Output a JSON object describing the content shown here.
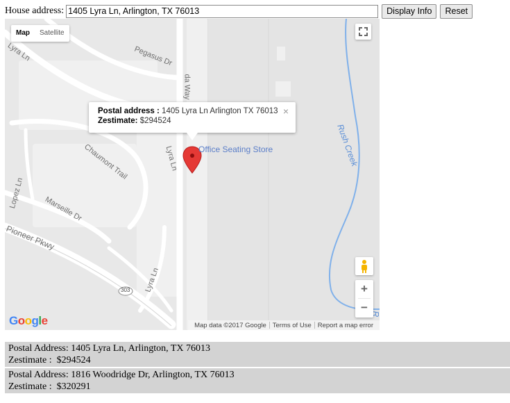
{
  "form": {
    "address_label": "House address:",
    "address_value": "1405 Lyra Ln, Arlington, TX 76013",
    "display_button": "Display Info",
    "reset_button": "Reset"
  },
  "map": {
    "type_options": [
      "Map",
      "Satellite"
    ],
    "streets": [
      "Pegasus Dr",
      "Lyra Ln",
      "Chaumont Trail",
      "Marseille Dr",
      "Pioneer Pkwy",
      "Lyra Ln",
      "Lyra Ln",
      "Lopez Ln",
      "303",
      "da Way"
    ],
    "creek_label": "Rush Creek",
    "creek_edge_label": "R",
    "poi_label": "Office Seating Store",
    "infowindow": {
      "postal_label": "Postal address :",
      "postal_value": "1405 Lyra Ln Arlington TX 76013",
      "zestimate_label": "Zestimate:",
      "zestimate_value": "$294524",
      "close_symbol": "×"
    },
    "attribution": [
      "Map data ©2017 Google",
      "Terms of Use",
      "Report a map error"
    ],
    "logo_letters": [
      "G",
      "o",
      "o",
      "g",
      "l",
      "e"
    ],
    "zoom_in": "+",
    "zoom_out": "−"
  },
  "results": [
    {
      "address_line": "Postal Address: 1405 Lyra Ln, Arlington, TX 76013",
      "zestimate_line": "Zestimate :  $294524"
    },
    {
      "address_line": "Postal Address: 1816 Woodridge Dr, Arlington, TX 76013",
      "zestimate_line": "Zestimate :  $320291"
    }
  ],
  "colors": {
    "map_bg": "#e6e6e6",
    "road": "#ffffff",
    "creek": "#7fb0ea",
    "marker": "#e53935",
    "poi": "#5b7ec8",
    "result_bg": "#d3d3d3",
    "logo": [
      "#4285f4",
      "#ea4335",
      "#fbbc05",
      "#4285f4",
      "#34a853",
      "#ea4335"
    ]
  }
}
